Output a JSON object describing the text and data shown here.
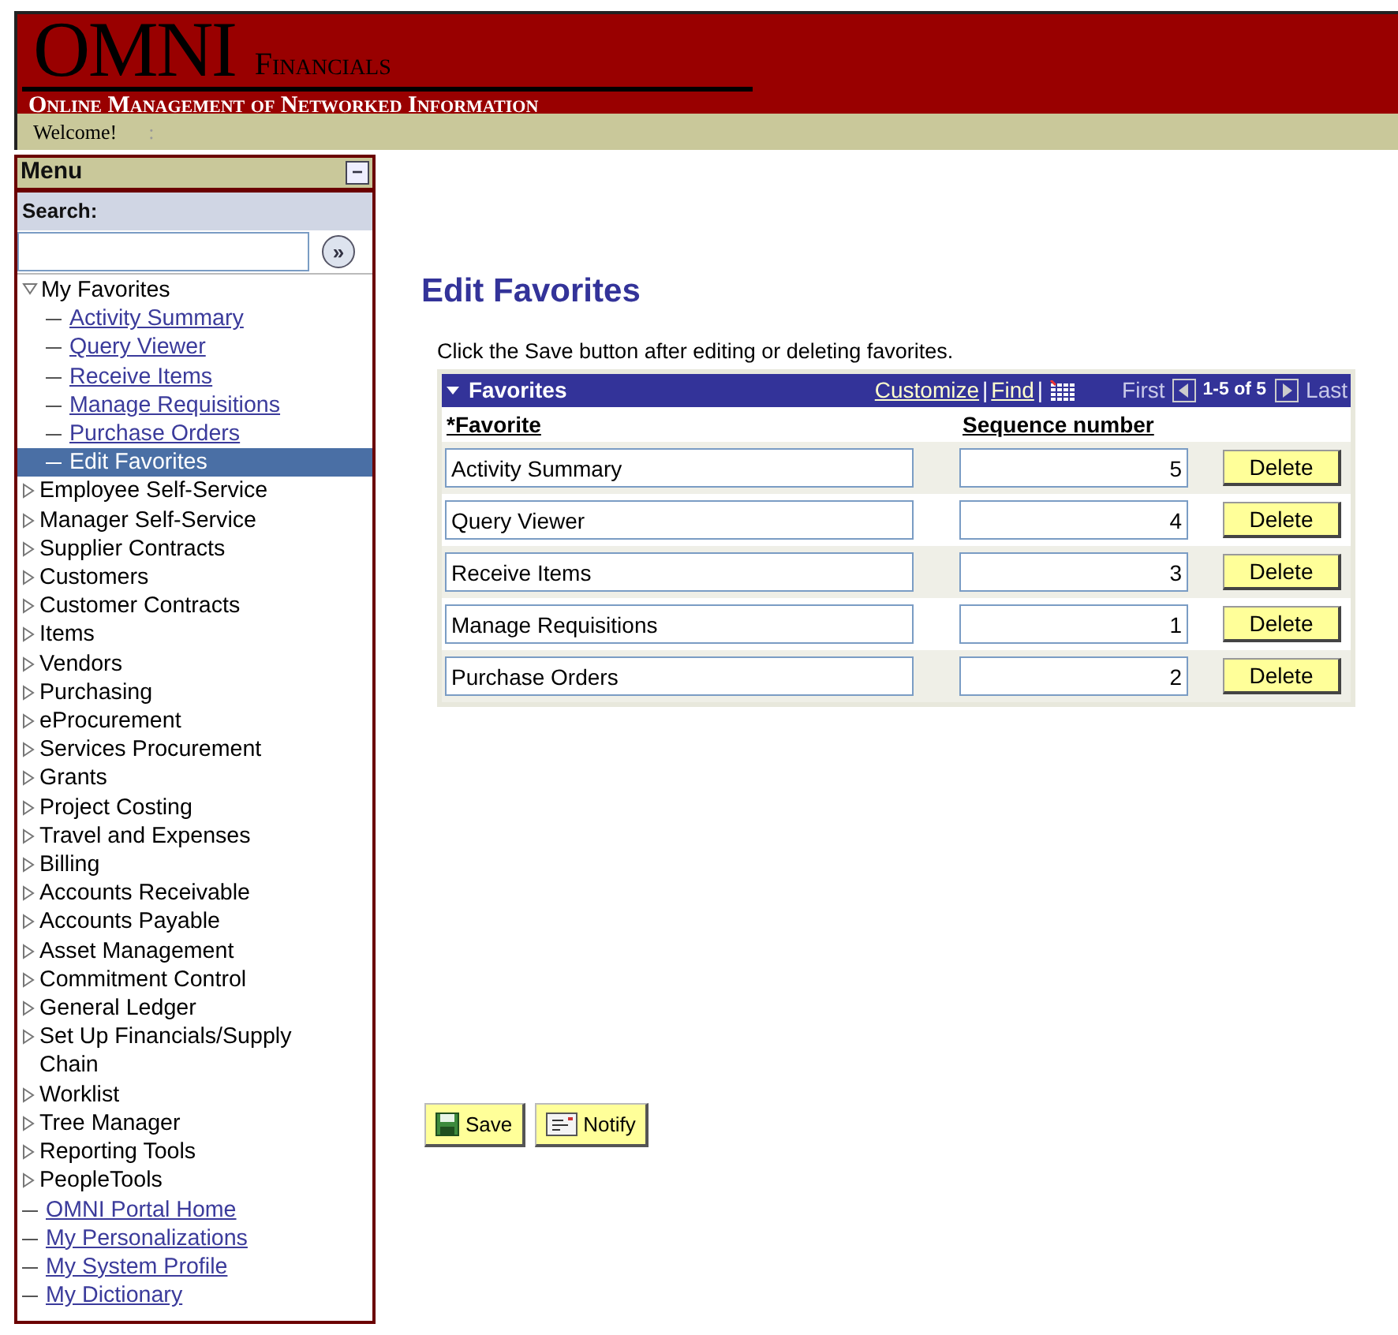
{
  "header": {
    "logo": "OMNI",
    "logo_suffix": "Financials",
    "tagline": "Online Management of Networked Information",
    "welcome": "Welcome!",
    "separator": ":"
  },
  "menu": {
    "title": "Menu",
    "collapse_button": "−",
    "search_label": "Search:",
    "search_button": "»",
    "items": [
      {
        "kind": "folder",
        "label": "My Favorites",
        "expanded": true,
        "selected": false,
        "children": [
          {
            "kind": "link",
            "label": "Activity Summary",
            "selected": false
          },
          {
            "kind": "link",
            "label": "Query Viewer",
            "selected": false
          },
          {
            "kind": "link",
            "label": "Receive Items",
            "selected": false
          },
          {
            "kind": "link",
            "label": "Manage Requisitions",
            "selected": false
          },
          {
            "kind": "link",
            "label": "Purchase Orders",
            "selected": false
          },
          {
            "kind": "link",
            "label": "Edit Favorites",
            "selected": true
          }
        ]
      },
      {
        "kind": "folder",
        "label": "Employee Self-Service",
        "expanded": false,
        "selected": false
      },
      {
        "kind": "folder",
        "label": "Manager Self-Service",
        "expanded": false,
        "selected": false
      },
      {
        "kind": "folder",
        "label": "Supplier Contracts",
        "expanded": false,
        "selected": false
      },
      {
        "kind": "folder",
        "label": "Customers",
        "expanded": false,
        "selected": false
      },
      {
        "kind": "folder",
        "label": "Customer Contracts",
        "expanded": false,
        "selected": false
      },
      {
        "kind": "folder",
        "label": "Items",
        "expanded": false,
        "selected": false
      },
      {
        "kind": "folder",
        "label": "Vendors",
        "expanded": false,
        "selected": false
      },
      {
        "kind": "folder",
        "label": "Purchasing",
        "expanded": false,
        "selected": false
      },
      {
        "kind": "folder",
        "label": "eProcurement",
        "expanded": false,
        "selected": false
      },
      {
        "kind": "folder",
        "label": "Services Procurement",
        "expanded": false,
        "selected": false
      },
      {
        "kind": "folder",
        "label": "Grants",
        "expanded": false,
        "selected": false
      },
      {
        "kind": "folder",
        "label": "Project Costing",
        "expanded": false,
        "selected": false
      },
      {
        "kind": "folder",
        "label": "Travel and Expenses",
        "expanded": false,
        "selected": false
      },
      {
        "kind": "folder",
        "label": "Billing",
        "expanded": false,
        "selected": false
      },
      {
        "kind": "folder",
        "label": "Accounts Receivable",
        "expanded": false,
        "selected": false
      },
      {
        "kind": "folder",
        "label": "Accounts Payable",
        "expanded": false,
        "selected": false
      },
      {
        "kind": "folder",
        "label": "Asset Management",
        "expanded": false,
        "selected": false
      },
      {
        "kind": "folder",
        "label": "Commitment Control",
        "expanded": false,
        "selected": false
      },
      {
        "kind": "folder",
        "label": "General Ledger",
        "expanded": false,
        "selected": false
      },
      {
        "kind": "folder",
        "label": "Set Up Financials/Supply Chain",
        "expanded": false,
        "selected": false
      },
      {
        "kind": "folder",
        "label": "Worklist",
        "expanded": false,
        "selected": false
      },
      {
        "kind": "folder",
        "label": "Tree Manager",
        "expanded": false,
        "selected": false
      },
      {
        "kind": "folder",
        "label": "Reporting Tools",
        "expanded": false,
        "selected": false
      },
      {
        "kind": "folder",
        "label": "PeopleTools",
        "expanded": false,
        "selected": false
      },
      {
        "kind": "link",
        "label": "OMNI Portal Home",
        "selected": false
      },
      {
        "kind": "link",
        "label": "My Personalizations",
        "selected": false
      },
      {
        "kind": "link",
        "label": "My System Profile",
        "selected": false
      },
      {
        "kind": "link",
        "label": "My Dictionary",
        "selected": false
      }
    ]
  },
  "page": {
    "title": "Edit Favorites",
    "instruction": "Click the Save button after editing or deleting favorites.",
    "grid": {
      "title": "Favorites",
      "links": [
        "Customize",
        "Find"
      ],
      "divider": "|",
      "first": "First",
      "range": "1-5 of 5",
      "last": "Last",
      "columns": [
        "*Favorite",
        "Sequence number"
      ],
      "rows": [
        {
          "favorite": "Activity Summary",
          "sequence": "5",
          "action": "Delete"
        },
        {
          "favorite": "Query Viewer",
          "sequence": "4",
          "action": "Delete"
        },
        {
          "favorite": "Receive Items",
          "sequence": "3",
          "action": "Delete"
        },
        {
          "favorite": "Manage Requisitions",
          "sequence": "1",
          "action": "Delete"
        },
        {
          "favorite": "Purchase Orders",
          "sequence": "2",
          "action": "Delete"
        }
      ]
    },
    "buttons": [
      {
        "kind": "save",
        "label": "Save"
      },
      {
        "kind": "notify",
        "label": "Notify"
      }
    ]
  }
}
